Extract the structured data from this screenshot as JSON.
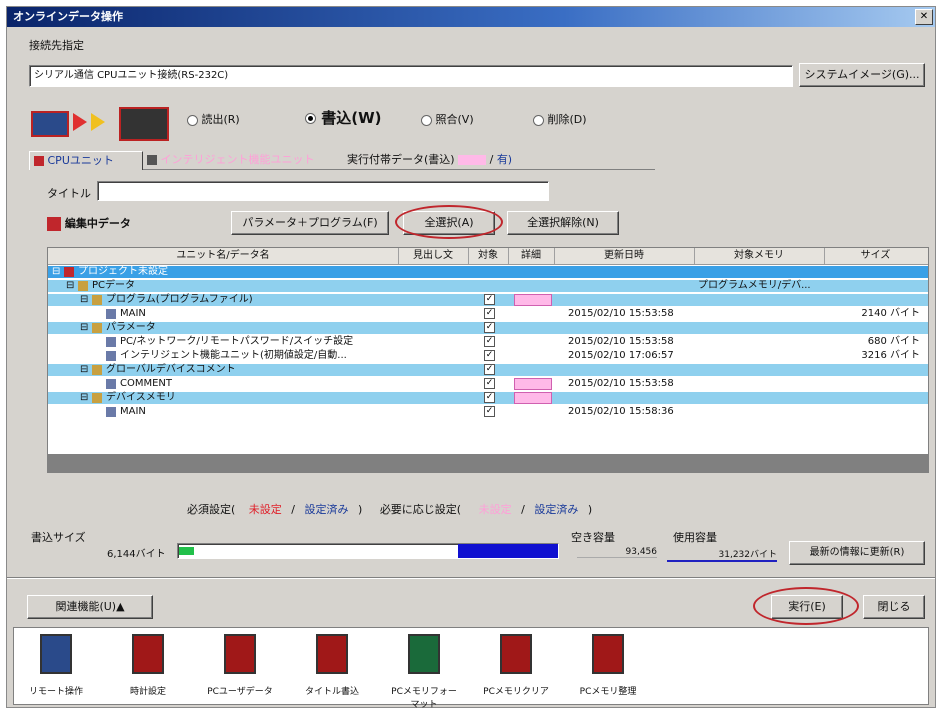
{
  "window": {
    "title": "オンラインデータ操作"
  },
  "connection": {
    "label": "接続先指定",
    "value": "シリアル通信 CPUユニット接続(RS-232C)",
    "system_image_button": "システムイメージ(G)..."
  },
  "operation": {
    "radio_read": "読出(R)",
    "radio_write": "書込(W)",
    "radio_verify": "照合(V)",
    "radio_delete": "削除(D)",
    "selected": "write"
  },
  "tabs": {
    "cpu_unit": "CPUユニット",
    "intelligent": "インテリジェント機能ユニット",
    "file_info": "実行付帯データ(書込)",
    "file_info_suffix": "/",
    "file_info_end": "有)"
  },
  "title_field": {
    "label": "タイトル",
    "value": ""
  },
  "editing": {
    "label": "編集中データ",
    "param_program_button": "パラメータ＋プログラム(F)",
    "select_all_button": "全選択(A)",
    "deselect_all_button": "全選択解除(N)"
  },
  "table": {
    "headers": [
      "ユニット名/データ名",
      "見出し文",
      "対象",
      "詳細",
      "更新日時",
      "対象メモリ",
      "サイズ"
    ],
    "rows": [
      {
        "name": "プロジェクト未設定",
        "indent": 0,
        "checked": false,
        "detail": false,
        "date": "",
        "memory": "",
        "size": "",
        "style": "sel"
      },
      {
        "name": "PCデータ",
        "indent": 1,
        "checked": false,
        "detail": false,
        "date": "",
        "memory": "プログラムメモリ/デバ...",
        "size": "",
        "style": "blue"
      },
      {
        "name": "プログラム(プログラムファイル)",
        "indent": 2,
        "checked": true,
        "detail": true,
        "date": "",
        "memory": "",
        "size": "",
        "style": "blue"
      },
      {
        "name": "MAIN",
        "indent": 3,
        "checked": true,
        "detail": false,
        "date": "2015/02/10 15:53:58",
        "memory": "",
        "size": "2140 バイト",
        "style": ""
      },
      {
        "name": "パラメータ",
        "indent": 2,
        "checked": true,
        "detail": false,
        "date": "",
        "memory": "",
        "size": "",
        "style": "blue"
      },
      {
        "name": "PC/ネットワーク/リモートパスワード/スイッチ設定",
        "indent": 3,
        "checked": true,
        "detail": false,
        "date": "2015/02/10 15:53:58",
        "memory": "",
        "size": "680 バイト",
        "style": ""
      },
      {
        "name": "インテリジェント機能ユニット(初期値設定/自動...",
        "indent": 3,
        "checked": true,
        "detail": false,
        "date": "2015/02/10 17:06:57",
        "memory": "",
        "size": "3216 バイト",
        "style": ""
      },
      {
        "name": "グローバルデバイスコメント",
        "indent": 2,
        "checked": true,
        "detail": false,
        "date": "",
        "memory": "",
        "size": "",
        "style": "blue"
      },
      {
        "name": "COMMENT",
        "indent": 3,
        "checked": true,
        "detail": true,
        "date": "2015/02/10 15:53:58",
        "memory": "",
        "size": "",
        "style": ""
      },
      {
        "name": "デバイスメモリ",
        "indent": 2,
        "checked": true,
        "detail": true,
        "date": "",
        "memory": "",
        "size": "",
        "style": "blue"
      },
      {
        "name": "MAIN",
        "indent": 3,
        "checked": true,
        "detail": false,
        "date": "2015/02/10 15:58:36",
        "memory": "",
        "size": "",
        "style": ""
      }
    ]
  },
  "legend": {
    "required": "必須設定(",
    "unset": "未設定",
    "sep1": "/",
    "set": "設定済み",
    "close1": ")",
    "optional": "必要に応じ設定(",
    "opt_unset": "未設定",
    "sep2": "/",
    "opt_set": "設定済み",
    "close2": ")"
  },
  "write_size": {
    "label": "書込サイズ",
    "value": "6,144バイト",
    "free_label": "空き容量",
    "free_value": "93,456",
    "used_label": "使用容量",
    "used_value": "31,232バイト",
    "update_button": "最新の情報に更新(R)"
  },
  "bottom": {
    "related_button": "関連機能(U)▲",
    "execute_button": "実行(E)",
    "close_button": "閉じる"
  },
  "toolbar": {
    "items": [
      {
        "label": "リモート操作",
        "icon": "remote-operation-icon"
      },
      {
        "label": "時計設定",
        "icon": "clock-setting-icon"
      },
      {
        "label": "PCユーザデータ",
        "icon": "pc-user-data-icon"
      },
      {
        "label": "タイトル書込",
        "icon": "title-write-icon"
      },
      {
        "label": "PCメモリフォーマット",
        "icon": "pc-memory-format-icon"
      },
      {
        "label": "PCメモリクリア",
        "icon": "pc-memory-clear-icon"
      },
      {
        "label": "PCメモリ整理",
        "icon": "pc-memory-arrange-icon"
      }
    ]
  },
  "colors": {
    "accent_red": "#c0262c",
    "selected_row": "#3aa0e6",
    "category_row": "#8fd0ee",
    "progress_green": "#22c04a",
    "progress_blue": "#1010d0"
  },
  "progress": {
    "write_fraction": 0.04
  }
}
